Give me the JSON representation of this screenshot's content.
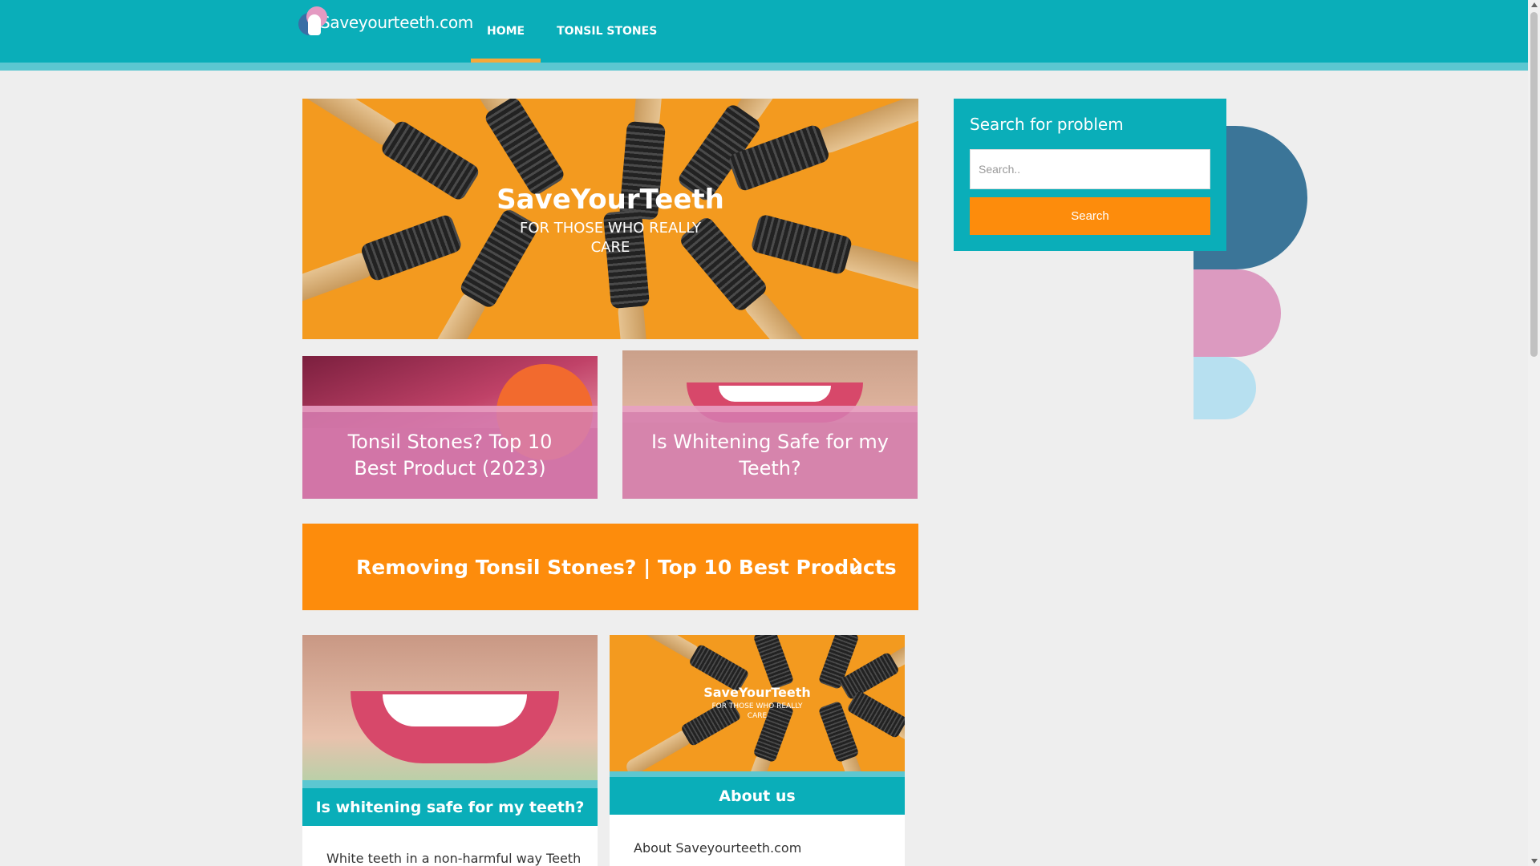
{
  "header": {
    "site_name": "Saveyourteeth.com",
    "nav": [
      {
        "label": "HOME",
        "active": true
      },
      {
        "label": "TONSIL STONES",
        "active": false
      }
    ]
  },
  "hero": {
    "title": "SaveYourTeeth",
    "subtitle": "FOR THOSE WHO REALLY CARE"
  },
  "featured": [
    {
      "title": "Tonsil Stones? Top 10 Best Product (2023)"
    },
    {
      "title": "Is Whitening Safe for my Teeth?"
    }
  ],
  "cta": {
    "label": "Removing Tonsil Stones? | Top 10 Best Products",
    "icon": "chevron-right-icon"
  },
  "posts": [
    {
      "title": "Is whitening safe for my teeth?",
      "excerpt": "White teeth in a non-harmful way Teeth"
    },
    {
      "title": "About us",
      "excerpt": "About Saveyourteeth.com",
      "image_title": "SaveYourTeeth",
      "image_subtitle": "FOR THOSE WHO REALLY CARE"
    }
  ],
  "sidebar": {
    "search_title": "Search for problem",
    "search_placeholder": "Search..",
    "search_button": "Search"
  },
  "colors": {
    "primary": "#0aaeb9",
    "accent": "#fd8c0c",
    "pink": "#d67eb2",
    "background": "#eeeeee"
  }
}
